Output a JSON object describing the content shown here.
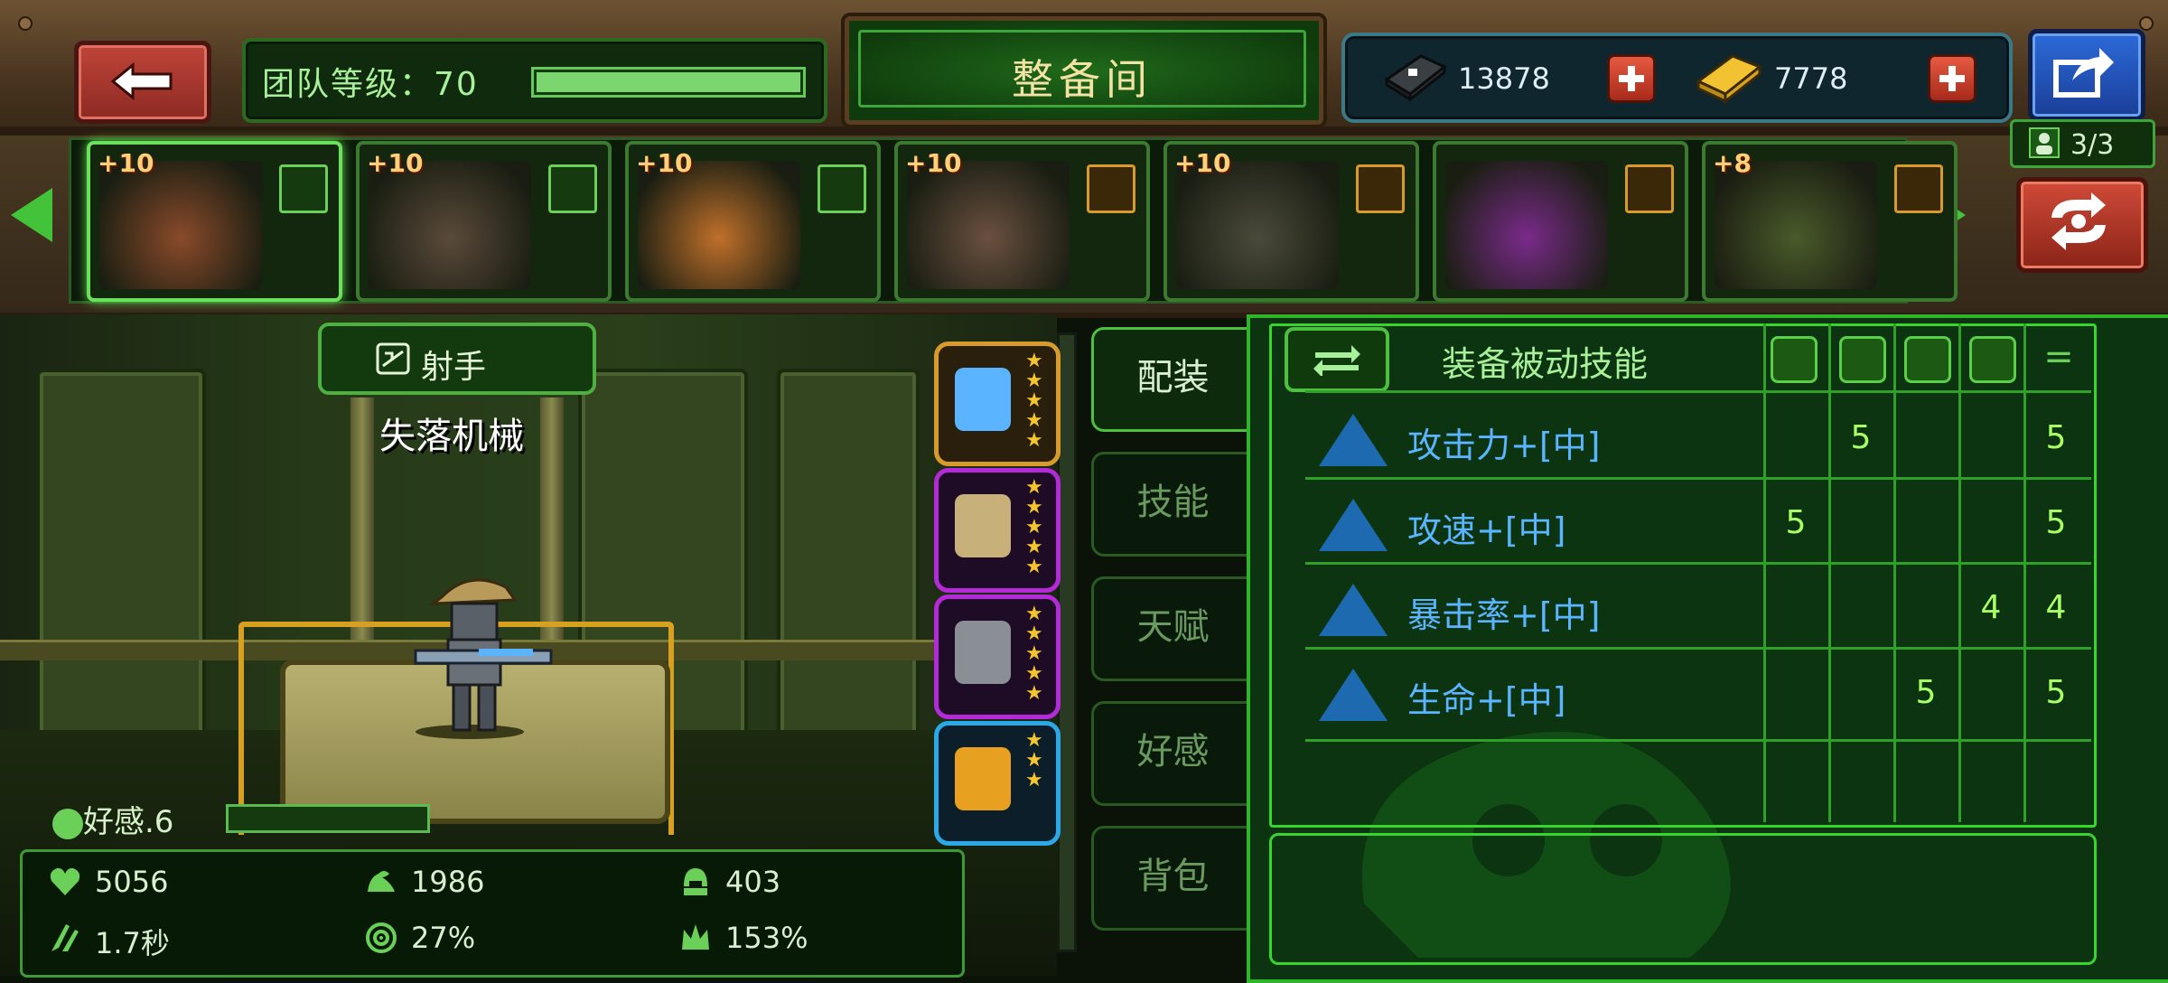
{
  "header": {
    "team_level_label": "团队等级：70",
    "team_level_progress": 1.0,
    "title": "整备间",
    "currency_1_value": "13878",
    "currency_2_value": "7778",
    "team_count": "3/3"
  },
  "roster": [
    {
      "level": "+10",
      "badge": "member",
      "name": "cowboy-hero"
    },
    {
      "level": "+10",
      "badge": "member",
      "name": "bearded-hero"
    },
    {
      "level": "+10",
      "badge": "member",
      "name": "cat-hero"
    },
    {
      "level": "+10",
      "badge": "support",
      "name": "masked-girl-hero"
    },
    {
      "level": "+10",
      "badge": "support",
      "name": "robot-hero"
    },
    {
      "level": "",
      "badge": "support",
      "name": "purple-beast-hero"
    },
    {
      "level": "+8",
      "badge": "support",
      "name": "soldier-hero"
    }
  ],
  "character": {
    "class_label": "射手",
    "name": "失落机械",
    "affinity_label": "好感.6",
    "stats": {
      "hp": "5056",
      "attack": "1986",
      "defense": "403",
      "attack_speed": "1.7秒",
      "crit_rate": "27%",
      "crit_damage": "153%"
    }
  },
  "equipment_slots": [
    {
      "rarity": "orange",
      "item": "rifle-icon",
      "stars": 5
    },
    {
      "rarity": "purple",
      "item": "helmet-icon",
      "stars": 5
    },
    {
      "rarity": "purple",
      "item": "armor-icon",
      "stars": 5
    },
    {
      "rarity": "blue",
      "item": "ring-icon",
      "stars": 3
    }
  ],
  "tabs": [
    "配装",
    "技能",
    "天赋",
    "好感",
    "背包"
  ],
  "active_tab": 0,
  "skills": {
    "header": "装备被动技能",
    "rows": [
      {
        "name": "攻击力+[中]",
        "cols": [
          "",
          "5",
          "",
          "",
          "5"
        ]
      },
      {
        "name": "攻速+[中]",
        "cols": [
          "5",
          "",
          "",
          "",
          "5"
        ]
      },
      {
        "name": "暴击率+[中]",
        "cols": [
          "",
          "",
          "",
          "4",
          "4"
        ]
      },
      {
        "name": "生命+[中]",
        "cols": [
          "",
          "",
          "5",
          "",
          "5"
        ]
      }
    ]
  },
  "colors": {
    "accent_green": "#3ad430",
    "skill_blue": "#5ab4ff",
    "number_green": "#a8ff66"
  }
}
